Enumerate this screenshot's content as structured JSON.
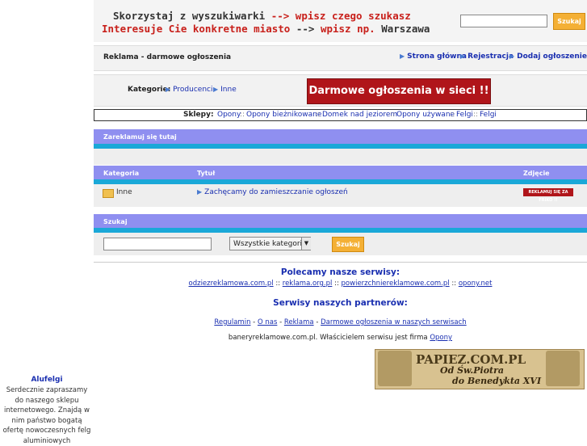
{
  "banner": {
    "line1_a": "Skorzystaj z wyszukiwarki",
    "line1_arrow": "-->",
    "line1_b": "wpisz czego szukasz",
    "line2_a": "Interesuje Cie konkretne miasto",
    "line2_arrow": "-->",
    "line2_b": "wpisz np.",
    "line2_c": "Warszawa",
    "search_button": "Szukaj"
  },
  "nav": {
    "title": "Reklama - darmowe ogłoszenia",
    "links": [
      "Strona główna",
      "Rejestracja",
      "Dodaj ogłoszenie"
    ]
  },
  "categories": {
    "label": "Kategorie:",
    "links": [
      "Producenci",
      "Inne"
    ],
    "ad_banner": "Darmowe ogłoszenia w sieci !!"
  },
  "shops": {
    "label": "Sklepy:",
    "links": [
      "Opony",
      "Opony bieżnikowane",
      "Domek nad jeziorem",
      "Opony używane",
      "Felgi",
      "Felgi"
    ]
  },
  "advertise": {
    "header": "Zareklamuj się tutaj"
  },
  "listing": {
    "col_category": "Kategoria",
    "col_title": "Tytuł",
    "col_image": "Zdjęcie",
    "rows": [
      {
        "category": "Inne",
        "title": "Zachęcamy do zamieszczanie ogłoszeń",
        "image_text": "REKLAMUJ SIĘ ZA FRIKO !!"
      }
    ]
  },
  "search": {
    "header": "Szukaj",
    "select_value": "Wszystkie kategorie",
    "button": "Szukaj"
  },
  "footer": {
    "recommend_heading": "Polecamy nasze serwisy:",
    "recommend_links": [
      "odziezreklamowa.com.pl",
      "reklama.org.pl",
      "powierzchniereklamowe.com.pl",
      "opony.net"
    ],
    "partners_heading": "Serwisy naszych partnerów:",
    "bottom_links": [
      "Regulamin",
      "O nas",
      "Reklama",
      "Darmowe ogłoszenia w naszych serwisach"
    ],
    "owner_text": "baneryreklamowe.com.pl. Właścicielem serwisu jest firma",
    "owner_link": "Opony",
    "papiez_title": "PAPIEZ.COM.PL",
    "papiez_line2": "Od Św.Piotra",
    "papiez_line3": "do Benedykta XVI"
  },
  "sidebar": {
    "title": "Alufelgi",
    "text": "Serdecznie zapraszamy do naszego sklepu internetowego. Znajdą w nim państwo bogatą ofertę nowoczesnych felg aluminiowych"
  },
  "colors": {
    "accent_purple": "#8f8ff0",
    "accent_blue": "#1aa8d8",
    "button_orange": "#f4b035",
    "link_blue": "#1a2fb0"
  }
}
